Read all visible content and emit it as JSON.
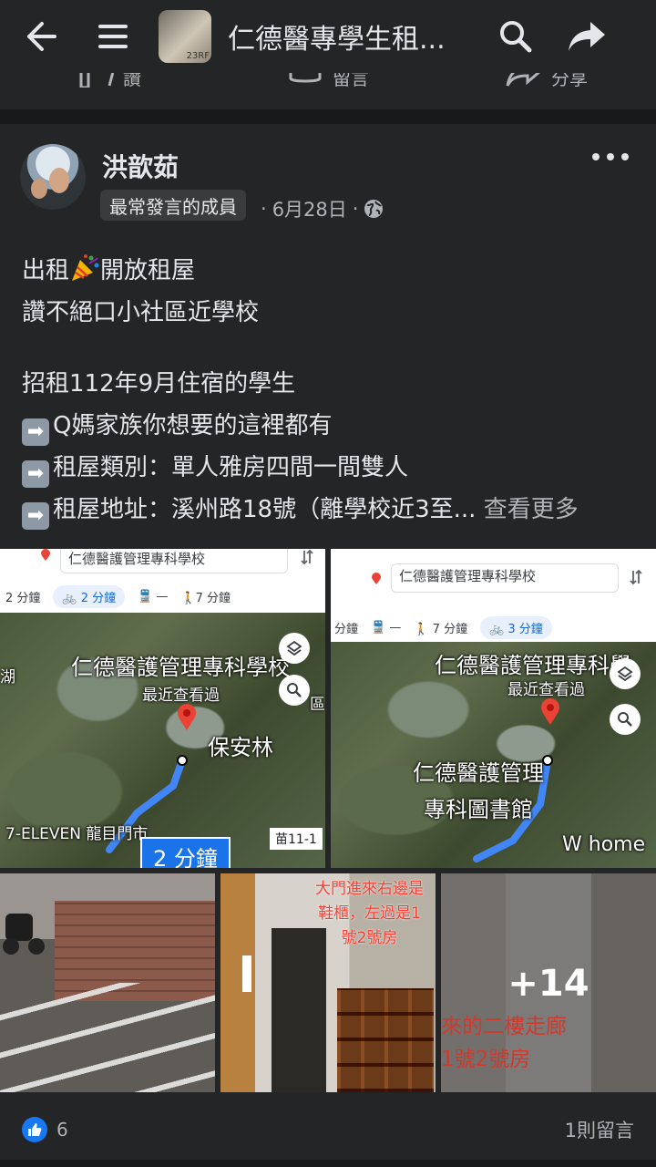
{
  "topbar": {
    "group_title": "仁德醫專學生租...",
    "group_avatar_text": "23RF",
    "icons": [
      "back-arrow-icon",
      "menu-icon",
      "search-icon",
      "share-icon"
    ]
  },
  "actionbar": {
    "items": [
      {
        "label": "讚",
        "icon": "like-outline-icon"
      },
      {
        "label": "留言",
        "icon": "comment-icon"
      },
      {
        "label": "分享",
        "icon": "share-outline-icon"
      }
    ]
  },
  "post": {
    "author": "洪歆茹",
    "badge": "最常發言的成員",
    "date": "6月28日",
    "separator": "·",
    "privacy_icon": "globe-icon",
    "lines": {
      "l1_a": "出租",
      "l1_b": "開放租屋",
      "l2": "讚不絕口小社區近學校",
      "l3": "招租112年9月住宿的學生",
      "l4": "Q媽家族你想要的這裡都有",
      "l5": "租屋類別：單人雅房四間一間雙人",
      "l6": "租屋地址：溪州路18號（離學校近3至...",
      "see_more": "查看更多"
    },
    "arrow_glyph": "➡"
  },
  "photos": {
    "map1": {
      "search_text": "仁德醫護管理專科學校",
      "modes": [
        "2 分鐘",
        "2 分鐘",
        "—",
        "7 分鐘"
      ],
      "labels": {
        "school": "仁德醫護管理專科學校",
        "recent": "最近查看過",
        "baoanlin": "保安林",
        "seven": "7-ELEVEN 龍目門市",
        "time": "2 分鐘",
        "road": "苗11-1",
        "left_char": "湖",
        "right_char": "區"
      }
    },
    "map2": {
      "search_text": "仁德醫護管理專科學校",
      "modes": [
        "分鐘",
        "—",
        "7 分鐘",
        "3 分鐘"
      ],
      "labels": {
        "school": "仁德醫護管理專科學",
        "recent": "最近查看過",
        "library_1": "仁德醫護管理",
        "library_2": "專科圖書館",
        "whome": "W home"
      }
    },
    "thumb2_note": "大門進來右邊是\n鞋櫃，左過是1\n號2號房",
    "thumb3": {
      "more_count": "+14",
      "text_1": "來的二樓走廊",
      "text_2": "1號2號房"
    }
  },
  "footer": {
    "like_count": "6",
    "comments": "1則留言"
  },
  "colors": {
    "bg": "#18191a",
    "card": "#242526",
    "text": "#e4e6eb",
    "muted": "#b0b3b8",
    "accent": "#1877f2"
  }
}
